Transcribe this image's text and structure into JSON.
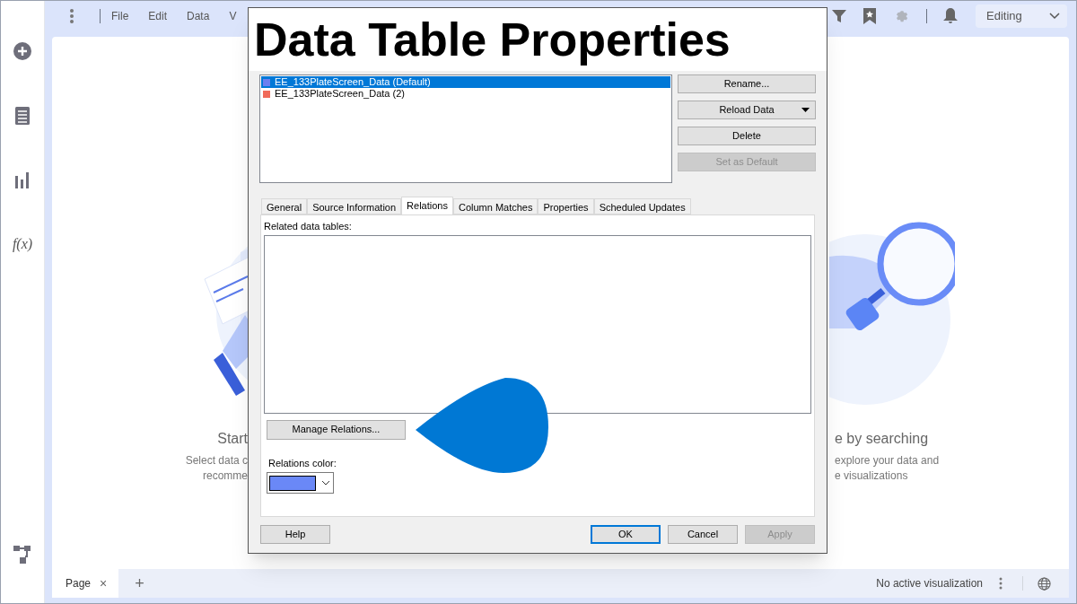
{
  "menu": [
    "File",
    "Edit",
    "Data",
    "V"
  ],
  "mode": {
    "label": "Editing"
  },
  "sidebar": {
    "formula_label": "f(x)"
  },
  "canvas": {
    "left_title": "Start",
    "left_lines": [
      "Select data c",
      "recomme"
    ],
    "right_title": "e by searching",
    "right_lines": [
      "explore your data and",
      "e visualizations"
    ]
  },
  "dialog": {
    "title": "Data Table Properties",
    "tables": [
      {
        "name": "EE_133PlateScreen_Data (Default)",
        "color": "#6b7ff0",
        "selected": true
      },
      {
        "name": "EE_133PlateScreen_Data (2)",
        "color": "#f06b5a",
        "selected": false
      }
    ],
    "side_buttons": [
      {
        "label": "Rename...",
        "kind": "plain",
        "disabled": false
      },
      {
        "label": "Reload Data",
        "kind": "dropdown",
        "disabled": false
      },
      {
        "label": "Delete",
        "kind": "plain",
        "disabled": false
      },
      {
        "label": "Set as Default",
        "kind": "plain",
        "disabled": true
      }
    ],
    "tabs": [
      {
        "label": "General",
        "selected": false
      },
      {
        "label": "Source Information",
        "selected": false
      },
      {
        "label": "Relations",
        "selected": true
      },
      {
        "label": "Column Matches",
        "selected": false
      },
      {
        "label": "Properties",
        "selected": false
      },
      {
        "label": "Scheduled Updates",
        "selected": false
      }
    ],
    "related_label": "Related data tables:",
    "manage_button": "Manage Relations...",
    "color_label": "Relations color:",
    "relations_swatch": {
      "color": "#6a88f7"
    },
    "footer_buttons": [
      {
        "label": "Help",
        "default": false,
        "disabled": false
      },
      {
        "label": "OK",
        "default": true,
        "disabled": false
      },
      {
        "label": "Cancel",
        "default": false,
        "disabled": false
      },
      {
        "label": "Apply",
        "default": false,
        "disabled": true
      }
    ]
  },
  "page_tabs": [
    {
      "label": "Page",
      "close": "×"
    }
  ],
  "add_tab": "+",
  "status": "No active visualization"
}
